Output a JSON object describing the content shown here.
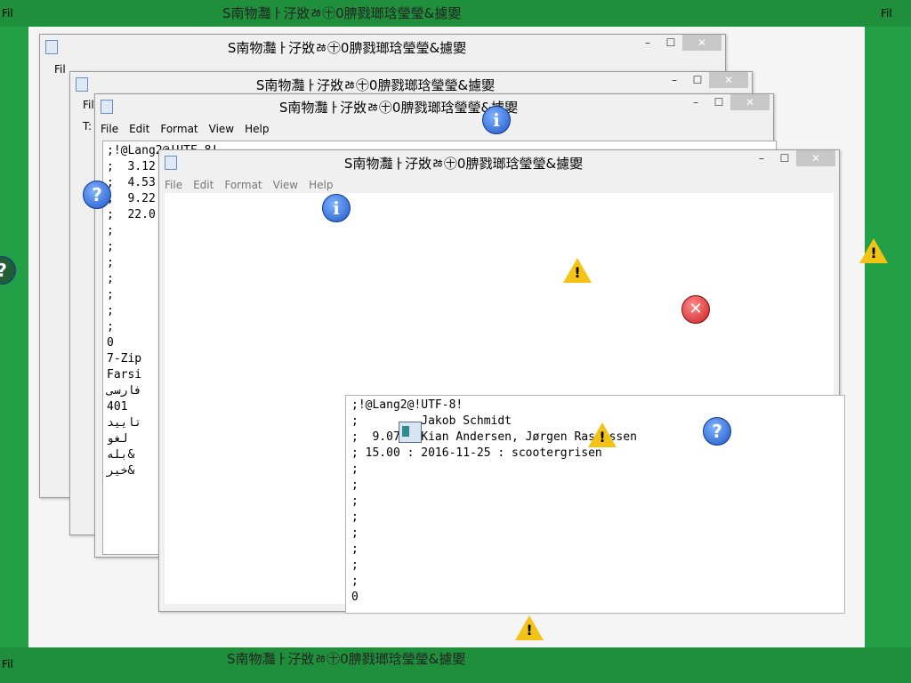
{
  "window_title": "S南物灩ￂ汓敚ﾰ㊉0腗戮瑯琀瑩瑩&攄夓",
  "menu": [
    "File",
    "Edit",
    "Format",
    "View",
    "Help"
  ],
  "trail_titles": [
    "S南物灩ￂ汓敚ﾰ㊉0腗戮瑯琀瑩瑩&攄夓",
    "S南物灩ￂ汓敚ﾰ㊉0腗戮瑯琀瑩瑩&攄夓"
  ],
  "trail_file_label": "Fil",
  "controls": {
    "minimize": "–",
    "maximize": "☐",
    "close": "✕"
  },
  "back_editor_lines": [
    ";!@Lang2@!UTF-8!",
    ";  3.12",
    ";  4.53",
    ";  9.22",
    ";  22.0",
    ";",
    ";",
    ";",
    ";",
    ";",
    ";",
    ";",
    "0",
    "7-Zip",
    "Farsi",
    "فارسی",
    "401",
    "تایید",
    "لغو",
    "",
    "",
    "بله&",
    "خیر&"
  ],
  "front_editor_lines": [
    ";!@Lang2@!UTF-8!",
    ";         Jakob Schmidt",
    ";  9.07 : Kian Andersen, Jørgen Rasmussen",
    "; 15.00 : 2016-11-25 : scootergrisen",
    ";",
    ";",
    ";",
    ";",
    ";",
    ";",
    ";",
    ";",
    "0"
  ],
  "side_label": "T:",
  "icons": {
    "info": "i",
    "question": "?",
    "error": "✕",
    "warning": "!"
  },
  "colors": {
    "desktop_green": "#23a046",
    "warning_yellow": "#f3c316",
    "error_red": "#c81f1f",
    "info_blue": "#1f56c8"
  }
}
